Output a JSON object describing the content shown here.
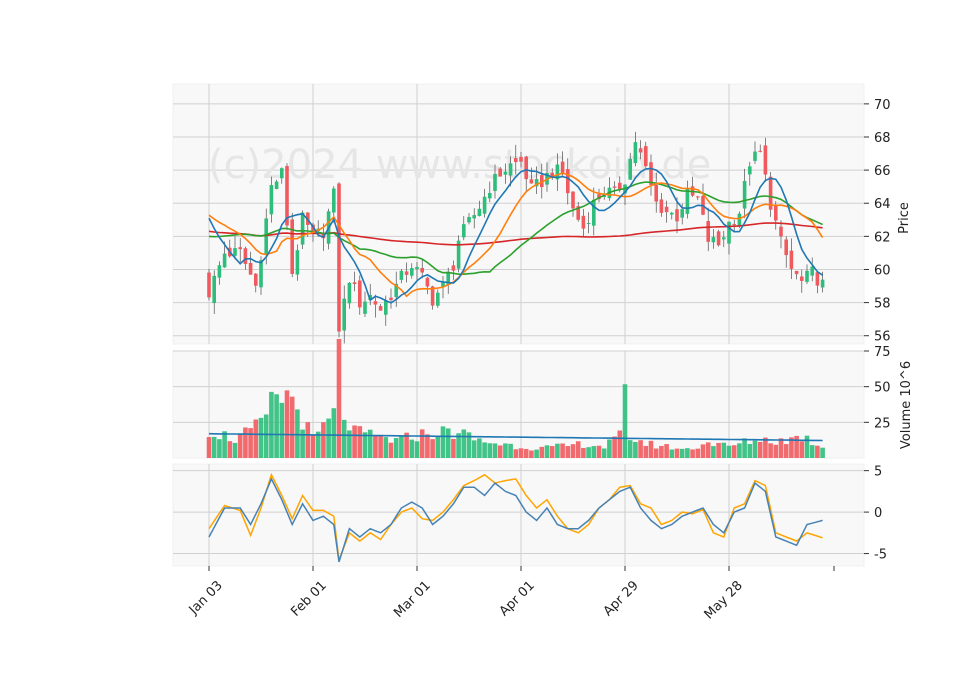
{
  "chart_data": {
    "type": "candlestick",
    "watermark": "(c)2024 www.stockoid.de",
    "x_labels": [
      "Jan 03",
      "Feb 01",
      "Mar 01",
      "Apr 01",
      "Apr 29",
      "May 28"
    ],
    "x_label_index": [
      0,
      20,
      40,
      60,
      80,
      100
    ],
    "n_days": 119,
    "price_panel": {
      "ylabel": "Price",
      "ylim": [
        55.5,
        71.2
      ],
      "yticks": [
        56,
        58,
        60,
        62,
        64,
        66,
        68,
        70
      ],
      "series_colors": {
        "up": "#2ebd7a",
        "down": "#f05a5e",
        "ma1": "#1f77b4",
        "ma2": "#ff7f0e",
        "ma3": "#2ca02c",
        "ma4": "#d62728"
      },
      "closes_anchor": [
        [
          0,
          58.6
        ],
        [
          3,
          61.0
        ],
        [
          6,
          61.0
        ],
        [
          9,
          59.0
        ],
        [
          12,
          65.0
        ],
        [
          14,
          65.8
        ],
        [
          16,
          59.8
        ],
        [
          18,
          63.0
        ],
        [
          20,
          62.0
        ],
        [
          22,
          62.3
        ],
        [
          24,
          64.5
        ],
        [
          25,
          56.5
        ],
        [
          27,
          59.5
        ],
        [
          29,
          58.0
        ],
        [
          31,
          58.4
        ],
        [
          33,
          57.6
        ],
        [
          35,
          58.5
        ],
        [
          37,
          59.5
        ],
        [
          39,
          60.3
        ],
        [
          41,
          59.5
        ],
        [
          43,
          58.2
        ],
        [
          45,
          59.0
        ],
        [
          47,
          60.3
        ],
        [
          48,
          61.8
        ],
        [
          50,
          62.8
        ],
        [
          52,
          63.8
        ],
        [
          54,
          65.0
        ],
        [
          56,
          65.8
        ],
        [
          58,
          66.3
        ],
        [
          60,
          66.5
        ],
        [
          62,
          64.8
        ],
        [
          64,
          65.3
        ],
        [
          66,
          66.0
        ],
        [
          68,
          65.8
        ],
        [
          70,
          63.6
        ],
        [
          72,
          62.5
        ],
        [
          74,
          64.0
        ],
        [
          76,
          64.8
        ],
        [
          78,
          64.5
        ],
        [
          80,
          65.5
        ],
        [
          82,
          67.8
        ],
        [
          84,
          66.0
        ],
        [
          86,
          64.0
        ],
        [
          88,
          63.5
        ],
        [
          90,
          63.2
        ],
        [
          92,
          64.5
        ],
        [
          94,
          64.2
        ],
        [
          96,
          61.8
        ],
        [
          98,
          61.5
        ],
        [
          100,
          62.8
        ],
        [
          102,
          63.5
        ],
        [
          104,
          66.5
        ],
        [
          106,
          67.0
        ],
        [
          108,
          64.0
        ],
        [
          110,
          61.6
        ],
        [
          112,
          60.0
        ],
        [
          114,
          59.2
        ],
        [
          116,
          59.8
        ],
        [
          118,
          59.1
        ]
      ]
    },
    "volume_panel": {
      "ylabel": "Volume  10^6",
      "ylim": [
        0,
        75
      ],
      "yticks": [
        25,
        50,
        75
      ],
      "volumes_anchor": [
        [
          0,
          20
        ],
        [
          5,
          13
        ],
        [
          10,
          23
        ],
        [
          13,
          44
        ],
        [
          16,
          42
        ],
        [
          20,
          13
        ],
        [
          24,
          30
        ],
        [
          25,
          70
        ],
        [
          26,
          30
        ],
        [
          28,
          18
        ],
        [
          32,
          15
        ],
        [
          36,
          12
        ],
        [
          40,
          16
        ],
        [
          44,
          18
        ],
        [
          48,
          18
        ],
        [
          52,
          12
        ],
        [
          56,
          10
        ],
        [
          60,
          8
        ],
        [
          64,
          7
        ],
        [
          68,
          8
        ],
        [
          72,
          10
        ],
        [
          76,
          8
        ],
        [
          79,
          15
        ],
        [
          80,
          43
        ],
        [
          81,
          15
        ],
        [
          84,
          10
        ],
        [
          88,
          8
        ],
        [
          92,
          6
        ],
        [
          96,
          11
        ],
        [
          100,
          8
        ],
        [
          104,
          12
        ],
        [
          106,
          13
        ],
        [
          110,
          12
        ],
        [
          114,
          15
        ],
        [
          118,
          8
        ]
      ]
    },
    "oscillator_panel": {
      "ylim": [
        -6.5,
        5.8
      ],
      "yticks": [
        -5,
        0,
        5
      ],
      "colors": {
        "line1": "#4682b4",
        "line2": "#ffa500"
      },
      "line1_anchor": [
        [
          0,
          -3.0
        ],
        [
          3,
          0.5
        ],
        [
          6,
          0.5
        ],
        [
          8,
          -1.5
        ],
        [
          10,
          1.0
        ],
        [
          12,
          4.0
        ],
        [
          14,
          1.5
        ],
        [
          16,
          -1.5
        ],
        [
          18,
          1.0
        ],
        [
          20,
          -1.0
        ],
        [
          22,
          -0.5
        ],
        [
          24,
          -1.5
        ],
        [
          25,
          -6.0
        ],
        [
          27,
          -2.0
        ],
        [
          29,
          -3.0
        ],
        [
          31,
          -2.0
        ],
        [
          33,
          -2.5
        ],
        [
          35,
          -1.5
        ],
        [
          37,
          0.5
        ],
        [
          39,
          1.2
        ],
        [
          41,
          0.5
        ],
        [
          43,
          -1.5
        ],
        [
          45,
          -0.5
        ],
        [
          47,
          1.0
        ],
        [
          49,
          3.0
        ],
        [
          51,
          3.0
        ],
        [
          53,
          2.0
        ],
        [
          55,
          3.5
        ],
        [
          57,
          2.5
        ],
        [
          59,
          2.0
        ],
        [
          61,
          0.0
        ],
        [
          63,
          -1.0
        ],
        [
          65,
          0.5
        ],
        [
          67,
          -1.5
        ],
        [
          69,
          -2.0
        ],
        [
          71,
          -2.0
        ],
        [
          73,
          -1.0
        ],
        [
          75,
          0.5
        ],
        [
          77,
          1.5
        ],
        [
          79,
          2.5
        ],
        [
          81,
          3.0
        ],
        [
          83,
          0.5
        ],
        [
          85,
          -1.0
        ],
        [
          87,
          -2.0
        ],
        [
          89,
          -1.5
        ],
        [
          91,
          -0.5
        ],
        [
          93,
          0.0
        ],
        [
          95,
          0.5
        ],
        [
          97,
          -1.5
        ],
        [
          99,
          -2.5
        ],
        [
          101,
          0.0
        ],
        [
          103,
          0.5
        ],
        [
          105,
          3.5
        ],
        [
          107,
          2.5
        ],
        [
          109,
          -3.0
        ],
        [
          111,
          -3.5
        ],
        [
          113,
          -4.0
        ],
        [
          115,
          -1.5
        ],
        [
          118,
          -1.0
        ]
      ],
      "line2_anchor": [
        [
          0,
          -2.0
        ],
        [
          3,
          0.8
        ],
        [
          6,
          0.2
        ],
        [
          8,
          -2.8
        ],
        [
          10,
          0.5
        ],
        [
          12,
          4.5
        ],
        [
          14,
          2.0
        ],
        [
          16,
          -0.8
        ],
        [
          18,
          2.0
        ],
        [
          20,
          0.2
        ],
        [
          22,
          0.2
        ],
        [
          24,
          -0.5
        ],
        [
          25,
          -5.8
        ],
        [
          27,
          -2.5
        ],
        [
          29,
          -3.5
        ],
        [
          31,
          -2.5
        ],
        [
          33,
          -3.3
        ],
        [
          35,
          -1.5
        ],
        [
          37,
          0.0
        ],
        [
          39,
          0.5
        ],
        [
          41,
          -0.8
        ],
        [
          43,
          -1.0
        ],
        [
          45,
          0.0
        ],
        [
          47,
          1.5
        ],
        [
          49,
          3.2
        ],
        [
          51,
          3.8
        ],
        [
          53,
          4.5
        ],
        [
          55,
          3.5
        ],
        [
          57,
          3.8
        ],
        [
          59,
          4.0
        ],
        [
          61,
          2.0
        ],
        [
          63,
          0.5
        ],
        [
          65,
          1.5
        ],
        [
          67,
          -0.5
        ],
        [
          69,
          -2.0
        ],
        [
          71,
          -2.5
        ],
        [
          73,
          -1.5
        ],
        [
          75,
          0.5
        ],
        [
          77,
          1.5
        ],
        [
          79,
          3.0
        ],
        [
          81,
          3.2
        ],
        [
          83,
          1.0
        ],
        [
          85,
          0.5
        ],
        [
          87,
          -1.5
        ],
        [
          89,
          -1.0
        ],
        [
          91,
          0.0
        ],
        [
          93,
          -0.2
        ],
        [
          95,
          0.3
        ],
        [
          97,
          -2.5
        ],
        [
          99,
          -3.0
        ],
        [
          101,
          0.5
        ],
        [
          103,
          1.0
        ],
        [
          105,
          3.8
        ],
        [
          107,
          3.2
        ],
        [
          109,
          -2.5
        ],
        [
          111,
          -3.0
        ],
        [
          113,
          -3.5
        ],
        [
          115,
          -2.5
        ],
        [
          118,
          -3.1
        ]
      ]
    }
  }
}
